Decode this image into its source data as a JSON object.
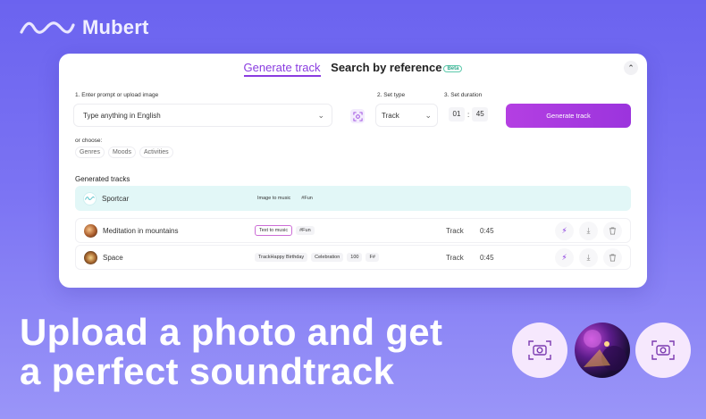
{
  "brand": {
    "name": "Mubert"
  },
  "tabs": {
    "generate": "Generate track",
    "search": "Search by reference",
    "beta": "Beta"
  },
  "form": {
    "prompt_label": "1. Enter prompt or upload image",
    "prompt_placeholder": "Type anything in English",
    "type_label": "2. Set type",
    "type_value": "Track",
    "duration_label": "3. Set duration",
    "duration_min": "01",
    "duration_sec": "45",
    "generate_button": "Generate track",
    "choose_label": "or choose:",
    "chips": [
      "Genres",
      "Moods",
      "Activities"
    ]
  },
  "generated": {
    "title": "Generated tracks",
    "rows": [
      {
        "name": "Sportcar",
        "tags": [
          "Image to music",
          "#Fun"
        ],
        "type": "",
        "duration": ""
      },
      {
        "name": "Meditation in mountains",
        "tags": [
          "Text to music",
          "#Fun"
        ],
        "type": "Track",
        "duration": "0:45"
      },
      {
        "name": "Space",
        "tags": [
          "TrackHappy Birthday",
          "Celebration",
          "100",
          "F#"
        ],
        "type": "Track",
        "duration": "0:45"
      }
    ]
  },
  "headline": {
    "line1": "Upload a photo and get",
    "line2": "a perfect soundtrack"
  },
  "colors": {
    "accent": "#8a3ce0",
    "button": "#a93adf",
    "background": "#7b73f3"
  }
}
